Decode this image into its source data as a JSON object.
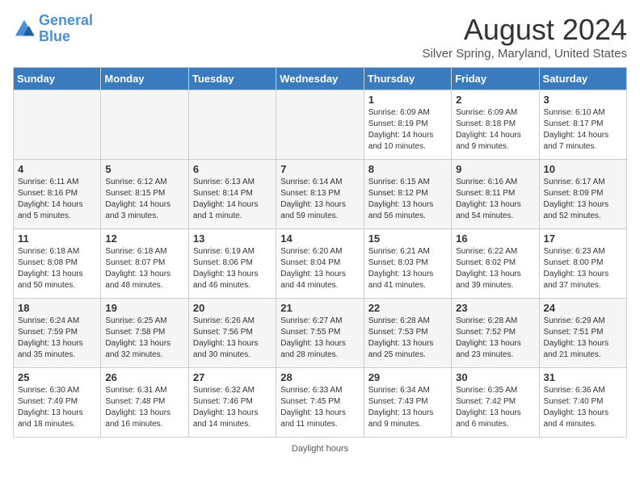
{
  "header": {
    "logo_line1": "General",
    "logo_line2": "Blue",
    "title": "August 2024",
    "subtitle": "Silver Spring, Maryland, United States"
  },
  "weekdays": [
    "Sunday",
    "Monday",
    "Tuesday",
    "Wednesday",
    "Thursday",
    "Friday",
    "Saturday"
  ],
  "footer": "Daylight hours",
  "weeks": [
    [
      {
        "num": "",
        "info": ""
      },
      {
        "num": "",
        "info": ""
      },
      {
        "num": "",
        "info": ""
      },
      {
        "num": "",
        "info": ""
      },
      {
        "num": "1",
        "info": "Sunrise: 6:09 AM\nSunset: 8:19 PM\nDaylight: 14 hours\nand 10 minutes."
      },
      {
        "num": "2",
        "info": "Sunrise: 6:09 AM\nSunset: 8:18 PM\nDaylight: 14 hours\nand 9 minutes."
      },
      {
        "num": "3",
        "info": "Sunrise: 6:10 AM\nSunset: 8:17 PM\nDaylight: 14 hours\nand 7 minutes."
      }
    ],
    [
      {
        "num": "4",
        "info": "Sunrise: 6:11 AM\nSunset: 8:16 PM\nDaylight: 14 hours\nand 5 minutes."
      },
      {
        "num": "5",
        "info": "Sunrise: 6:12 AM\nSunset: 8:15 PM\nDaylight: 14 hours\nand 3 minutes."
      },
      {
        "num": "6",
        "info": "Sunrise: 6:13 AM\nSunset: 8:14 PM\nDaylight: 14 hours\nand 1 minute."
      },
      {
        "num": "7",
        "info": "Sunrise: 6:14 AM\nSunset: 8:13 PM\nDaylight: 13 hours\nand 59 minutes."
      },
      {
        "num": "8",
        "info": "Sunrise: 6:15 AM\nSunset: 8:12 PM\nDaylight: 13 hours\nand 56 minutes."
      },
      {
        "num": "9",
        "info": "Sunrise: 6:16 AM\nSunset: 8:11 PM\nDaylight: 13 hours\nand 54 minutes."
      },
      {
        "num": "10",
        "info": "Sunrise: 6:17 AM\nSunset: 8:09 PM\nDaylight: 13 hours\nand 52 minutes."
      }
    ],
    [
      {
        "num": "11",
        "info": "Sunrise: 6:18 AM\nSunset: 8:08 PM\nDaylight: 13 hours\nand 50 minutes."
      },
      {
        "num": "12",
        "info": "Sunrise: 6:18 AM\nSunset: 8:07 PM\nDaylight: 13 hours\nand 48 minutes."
      },
      {
        "num": "13",
        "info": "Sunrise: 6:19 AM\nSunset: 8:06 PM\nDaylight: 13 hours\nand 46 minutes."
      },
      {
        "num": "14",
        "info": "Sunrise: 6:20 AM\nSunset: 8:04 PM\nDaylight: 13 hours\nand 44 minutes."
      },
      {
        "num": "15",
        "info": "Sunrise: 6:21 AM\nSunset: 8:03 PM\nDaylight: 13 hours\nand 41 minutes."
      },
      {
        "num": "16",
        "info": "Sunrise: 6:22 AM\nSunset: 8:02 PM\nDaylight: 13 hours\nand 39 minutes."
      },
      {
        "num": "17",
        "info": "Sunrise: 6:23 AM\nSunset: 8:00 PM\nDaylight: 13 hours\nand 37 minutes."
      }
    ],
    [
      {
        "num": "18",
        "info": "Sunrise: 6:24 AM\nSunset: 7:59 PM\nDaylight: 13 hours\nand 35 minutes."
      },
      {
        "num": "19",
        "info": "Sunrise: 6:25 AM\nSunset: 7:58 PM\nDaylight: 13 hours\nand 32 minutes."
      },
      {
        "num": "20",
        "info": "Sunrise: 6:26 AM\nSunset: 7:56 PM\nDaylight: 13 hours\nand 30 minutes."
      },
      {
        "num": "21",
        "info": "Sunrise: 6:27 AM\nSunset: 7:55 PM\nDaylight: 13 hours\nand 28 minutes."
      },
      {
        "num": "22",
        "info": "Sunrise: 6:28 AM\nSunset: 7:53 PM\nDaylight: 13 hours\nand 25 minutes."
      },
      {
        "num": "23",
        "info": "Sunrise: 6:28 AM\nSunset: 7:52 PM\nDaylight: 13 hours\nand 23 minutes."
      },
      {
        "num": "24",
        "info": "Sunrise: 6:29 AM\nSunset: 7:51 PM\nDaylight: 13 hours\nand 21 minutes."
      }
    ],
    [
      {
        "num": "25",
        "info": "Sunrise: 6:30 AM\nSunset: 7:49 PM\nDaylight: 13 hours\nand 18 minutes."
      },
      {
        "num": "26",
        "info": "Sunrise: 6:31 AM\nSunset: 7:48 PM\nDaylight: 13 hours\nand 16 minutes."
      },
      {
        "num": "27",
        "info": "Sunrise: 6:32 AM\nSunset: 7:46 PM\nDaylight: 13 hours\nand 14 minutes."
      },
      {
        "num": "28",
        "info": "Sunrise: 6:33 AM\nSunset: 7:45 PM\nDaylight: 13 hours\nand 11 minutes."
      },
      {
        "num": "29",
        "info": "Sunrise: 6:34 AM\nSunset: 7:43 PM\nDaylight: 13 hours\nand 9 minutes."
      },
      {
        "num": "30",
        "info": "Sunrise: 6:35 AM\nSunset: 7:42 PM\nDaylight: 13 hours\nand 6 minutes."
      },
      {
        "num": "31",
        "info": "Sunrise: 6:36 AM\nSunset: 7:40 PM\nDaylight: 13 hours\nand 4 minutes."
      }
    ]
  ]
}
